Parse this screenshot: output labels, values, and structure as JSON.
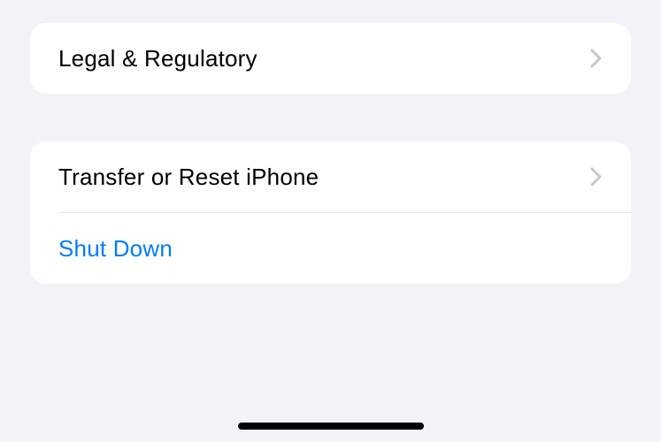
{
  "groups": [
    {
      "rows": [
        {
          "label": "Legal & Regulatory",
          "has_chevron": true,
          "style": "default"
        }
      ]
    },
    {
      "rows": [
        {
          "label": "Transfer or Reset iPhone",
          "has_chevron": true,
          "style": "default"
        },
        {
          "label": "Shut Down",
          "has_chevron": false,
          "style": "link"
        }
      ]
    }
  ]
}
